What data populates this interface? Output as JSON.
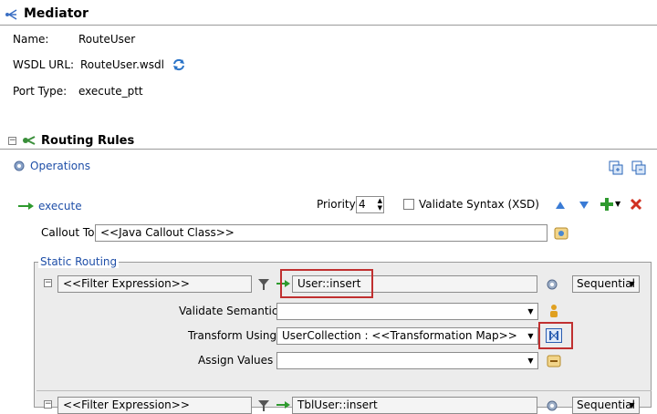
{
  "mediator": {
    "title": "Mediator",
    "name_label": "Name:",
    "name_value": "RouteUser",
    "wsdl_label": "WSDL URL:",
    "wsdl_value": "RouteUser.wsdl",
    "porttype_label": "Port Type:",
    "porttype_value": "execute_ptt"
  },
  "routing": {
    "title": "Routing Rules",
    "operations_label": "Operations",
    "operation_name": "execute",
    "priority_label": "Priority",
    "priority_value": "4",
    "validate_syntax_label": "Validate Syntax (XSD)",
    "callout_label": "Callout To",
    "callout_value": "<<Java Callout Class>>",
    "static_routing_label": "Static Routing",
    "rule1": {
      "filter_expression": "<<Filter Expression>>",
      "target": "User::insert",
      "execution_mode": "Sequential",
      "validate_semantic_label": "Validate Semantic",
      "validate_semantic_value": "",
      "transform_label": "Transform Using",
      "transform_value": "UserCollection : <<Transformation Map>>",
      "assign_label": "Assign Values",
      "assign_value": ""
    },
    "rule2": {
      "filter_expression": "<<Filter Expression>>",
      "target": "TblUser::insert",
      "execution_mode": "Sequential"
    }
  },
  "colors": {
    "accent_blue": "#1f4fa8",
    "highlight_red": "#c03030",
    "arrow_green": "#2e9a2e"
  }
}
